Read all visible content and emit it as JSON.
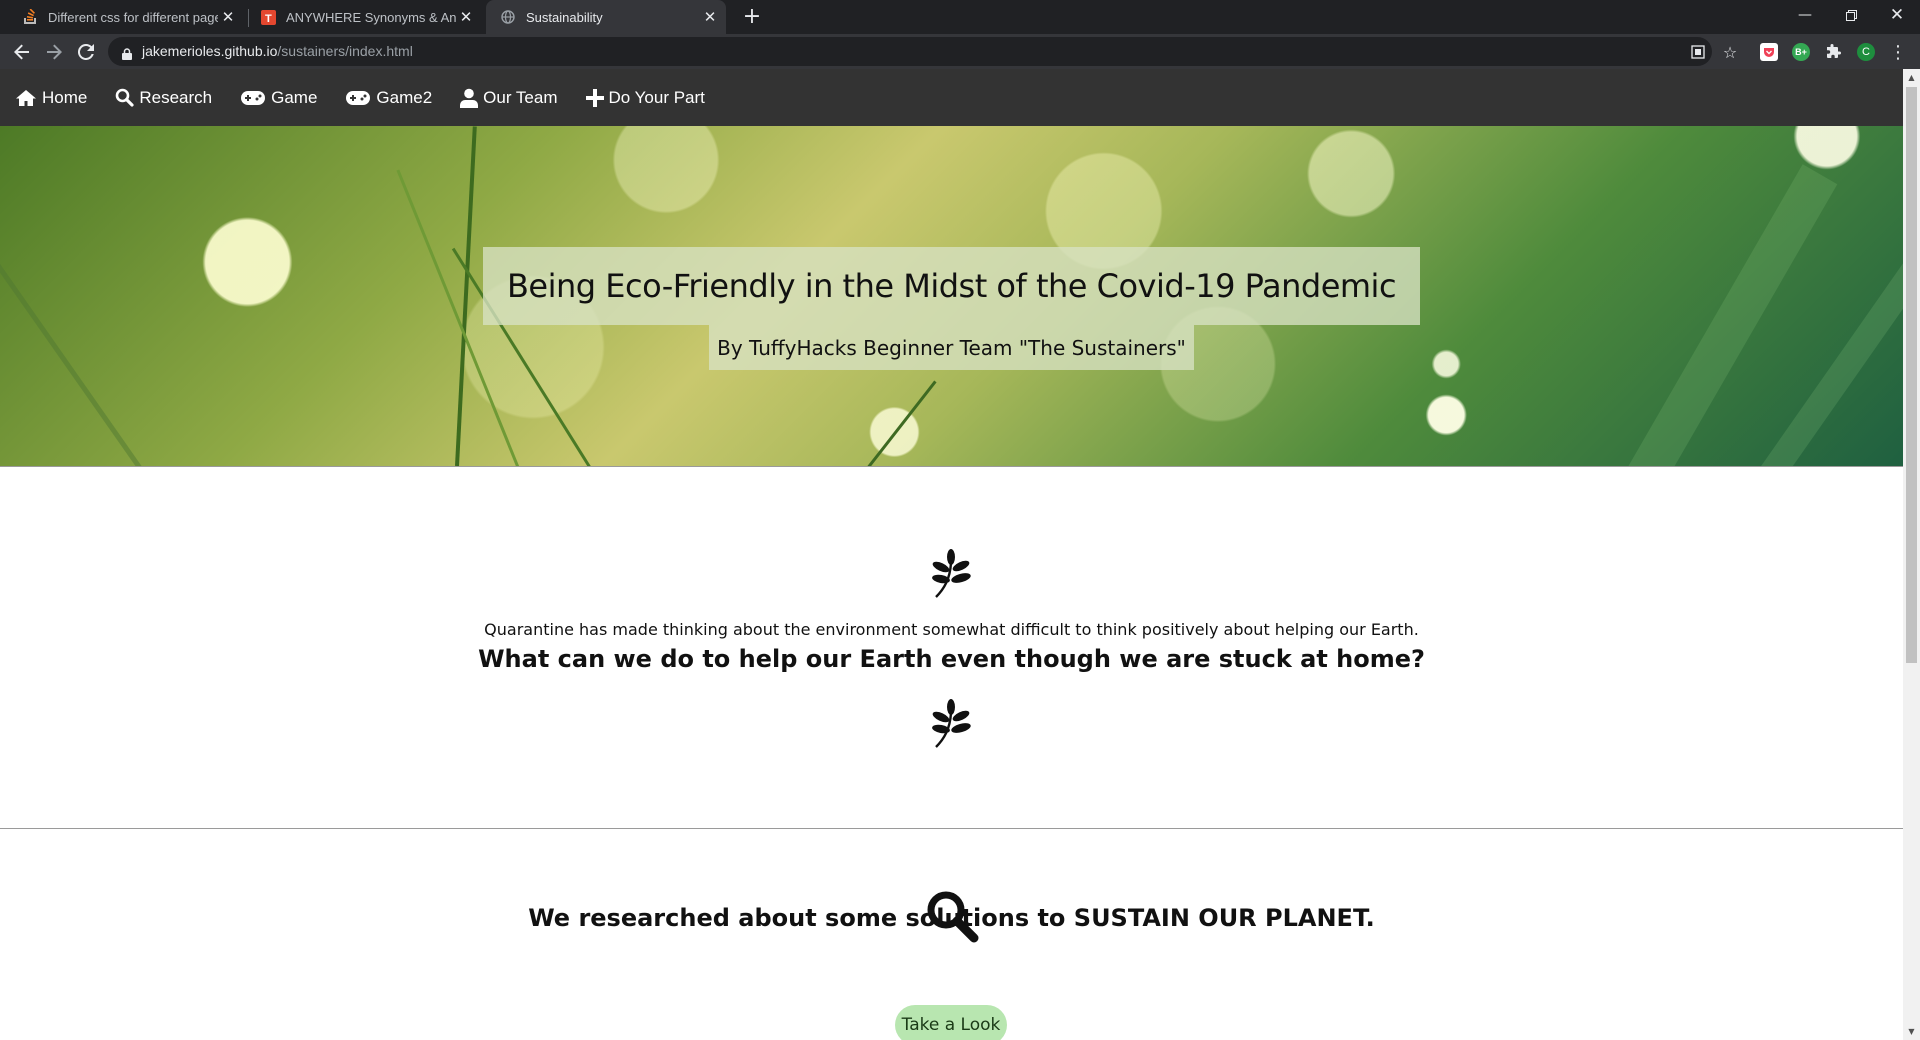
{
  "browser": {
    "tabs": [
      {
        "title": "Different css for different pages"
      },
      {
        "title": "ANYWHERE Synonyms & Antony"
      },
      {
        "title": "Sustainability"
      }
    ],
    "url_host": "jakemerioles.github.io",
    "url_path": "/sustainers/index.html",
    "profile_initial": "C",
    "extension_badge": "B+"
  },
  "nav": {
    "items": [
      {
        "label": "Home",
        "icon": "home-icon"
      },
      {
        "label": "Research",
        "icon": "search-icon"
      },
      {
        "label": "Game",
        "icon": "gamepad-icon"
      },
      {
        "label": "Game2",
        "icon": "gamepad-icon"
      },
      {
        "label": "Our Team",
        "icon": "user-icon"
      },
      {
        "label": "Do Your Part",
        "icon": "plus-icon"
      }
    ]
  },
  "hero": {
    "title": "Being Eco-Friendly in the Midst of the Covid-19 Pandemic",
    "subtitle": "By TuffyHacks Beginner Team \"The Sustainers\""
  },
  "intro": {
    "text": "Quarantine has made thinking about the environment somewhat difficult to think positively about helping our Earth.",
    "question": "What can we do to help our Earth even though we are stuck at home?"
  },
  "research": {
    "heading": "We researched about some solutions to SUSTAIN OUR PLANET.",
    "button_label": "Take a Look"
  },
  "colors": {
    "nav_bg": "#333333",
    "button_bg": "#b8e6b0"
  }
}
